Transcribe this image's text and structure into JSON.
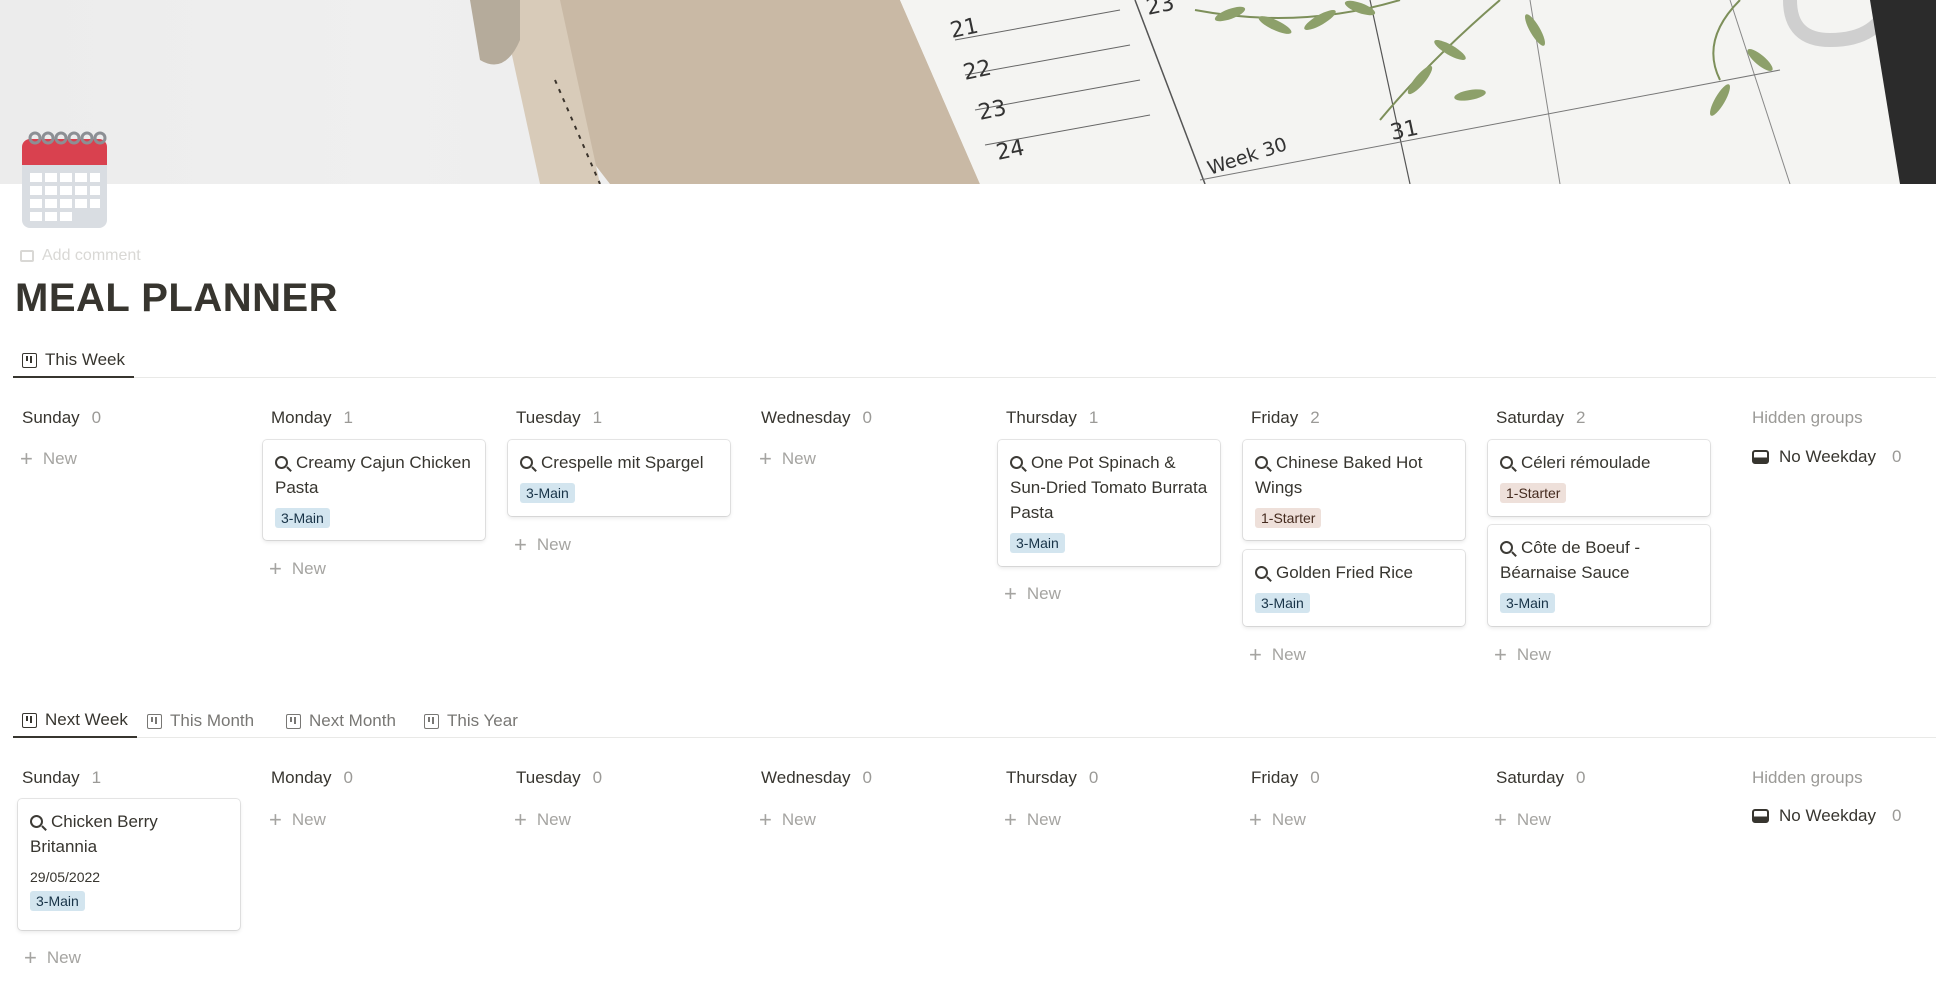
{
  "page": {
    "title": "MEAL PLANNER",
    "add_comment": "Add comment",
    "icon": "calendar-icon"
  },
  "cover": {
    "numbers": [
      "21",
      "22",
      "23",
      "24",
      "23",
      "31"
    ],
    "week_label": "Week 30"
  },
  "colors": {
    "text": "#37352f",
    "muted": "#9b9a97",
    "tag_main_bg": "#d3e5ef",
    "tag_starter_bg": "#eee0da",
    "calendar_red": "#d9414f"
  },
  "views_top": {
    "tabs": [
      {
        "label": "This Week",
        "icon": "board-icon",
        "active": true
      }
    ]
  },
  "views_bottom": {
    "tabs": [
      {
        "label": "Next Week",
        "icon": "board-icon",
        "active": true
      },
      {
        "label": "This Month",
        "icon": "board-icon",
        "active": false
      },
      {
        "label": "Next Month",
        "icon": "board-icon",
        "active": false
      },
      {
        "label": "This Year",
        "icon": "board-icon",
        "active": false
      }
    ]
  },
  "new_label": "New",
  "hidden_groups_label": "Hidden groups",
  "this_week": {
    "columns": [
      {
        "day": "Sunday",
        "count": "0",
        "cards": []
      },
      {
        "day": "Monday",
        "count": "1",
        "cards": [
          {
            "title": "Creamy Cajun Chicken Pasta",
            "tag": "3-Main"
          }
        ]
      },
      {
        "day": "Tuesday",
        "count": "1",
        "cards": [
          {
            "title": "Crespelle mit Spargel",
            "tag": "3-Main"
          }
        ]
      },
      {
        "day": "Wednesday",
        "count": "0",
        "cards": []
      },
      {
        "day": "Thursday",
        "count": "1",
        "cards": [
          {
            "title": "One Pot Spinach & Sun-Dried Tomato Burrata Pasta",
            "tag": "3-Main"
          }
        ]
      },
      {
        "day": "Friday",
        "count": "2",
        "cards": [
          {
            "title": "Chinese Baked Hot Wings",
            "tag": "1-Starter"
          },
          {
            "title": "Golden Fried Rice",
            "tag": "3-Main"
          }
        ]
      },
      {
        "day": "Saturday",
        "count": "2",
        "cards": [
          {
            "title": "Céleri rémoulade",
            "tag": "1-Starter"
          },
          {
            "title": "Côte de Boeuf - Béarnaise Sauce",
            "tag": "3-Main"
          }
        ]
      }
    ],
    "hidden": {
      "label": "No Weekday",
      "count": "0"
    }
  },
  "next_week": {
    "columns": [
      {
        "day": "Sunday",
        "count": "1",
        "cards": [
          {
            "title": "Chicken Berry Britannia",
            "date": "29/05/2022",
            "tag": "3-Main"
          }
        ]
      },
      {
        "day": "Monday",
        "count": "0",
        "cards": []
      },
      {
        "day": "Tuesday",
        "count": "0",
        "cards": []
      },
      {
        "day": "Wednesday",
        "count": "0",
        "cards": []
      },
      {
        "day": "Thursday",
        "count": "0",
        "cards": []
      },
      {
        "day": "Friday",
        "count": "0",
        "cards": []
      },
      {
        "day": "Saturday",
        "count": "0",
        "cards": []
      }
    ],
    "hidden": {
      "label": "No Weekday",
      "count": "0"
    }
  }
}
